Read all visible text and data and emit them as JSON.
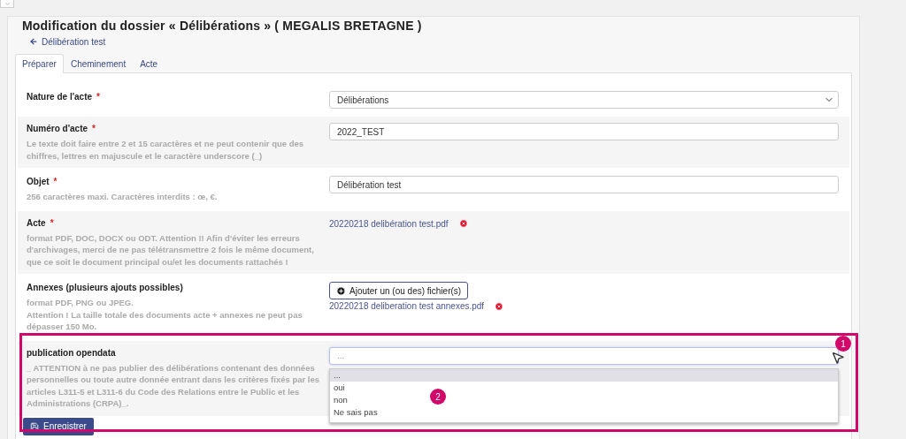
{
  "title": "Modification du dossier « Délibérations » ( MEGALIS BRETAGNE )",
  "back_link": "Délibération test",
  "tabs": [
    {
      "label": "Préparer",
      "selected": true
    },
    {
      "label": "Cheminement",
      "selected": false
    },
    {
      "label": "Acte",
      "selected": false
    }
  ],
  "fields": [
    {
      "kind": "select",
      "label": "Nature de l'acte",
      "required_mark": "*",
      "value": "Délibérations"
    },
    {
      "kind": "input",
      "label": "Numéro d'acte",
      "required_mark": "*",
      "help": "Le texte doit faire entre 2 et 15 caractères et ne peut contenir que des chiffres, lettres en majuscule et le caractère underscore (_)",
      "value": "2022_TEST"
    },
    {
      "kind": "input",
      "label": "Objet",
      "required_mark": "*",
      "help": "256 caractères maxi. Caractères interdits : œ, €.",
      "value": "Délibération test"
    },
    {
      "kind": "file",
      "label": "Acte",
      "required_mark": "*",
      "help": "format PDF, DOC, DOCX ou ODT. Attention !! Afin d'éviter les erreurs d'archivages, merci de ne pas télétransmettre 2 fois le même document, que ce soit le document principal ou/et les documents rattachés !",
      "file": "20220218 delibération test.pdf"
    },
    {
      "kind": "upload",
      "label": "Annexes (plusieurs ajouts possibles)",
      "help": "format PDF, PNG ou JPEG.\nAttention ! La taille totale des documents acte + annexes ne peut pas dépasser 150 Mo.",
      "button": "Ajouter un (ou des) fichier(s)",
      "file": "20220218 deliberation test annexes.pdf"
    },
    {
      "kind": "combo",
      "label": "publication opendata",
      "help": "_ ATTENTION à ne pas publier des délibérations contenant des données personnelles ou toute autre donnée entrant dans les critères fixés par les articles L311-5 et L311-6 du Code des Relations entre le Public et les Administrations (CRPA)_.",
      "placeholder": "...",
      "options": [
        {
          "label": "...",
          "selected": true
        },
        {
          "label": "oui",
          "selected": false
        },
        {
          "label": "non",
          "selected": false
        },
        {
          "label": "Ne sais pas",
          "selected": false
        }
      ]
    }
  ],
  "save_button": "Enregistrer",
  "annotations": [
    "1",
    "2"
  ]
}
